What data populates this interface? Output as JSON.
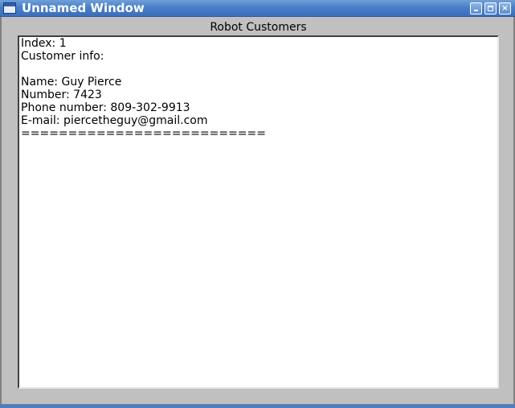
{
  "window": {
    "title": "Unnamed Window",
    "buttons": {
      "minimize": "",
      "maximize": "",
      "close": "×"
    }
  },
  "panel": {
    "label": "Robot Customers"
  },
  "textarea": {
    "lines": [
      "Index: 1",
      "Customer info:",
      "",
      "Name: Guy Pierce",
      "Number: 7423",
      "Phone number: 809-302-9913",
      "E-mail: piercetheguy@gmail.com",
      "=========================="
    ]
  },
  "colors": {
    "titlebar": "#4a7fc8",
    "window_bg": "#c0c0c0",
    "text_bg": "#ffffff"
  }
}
